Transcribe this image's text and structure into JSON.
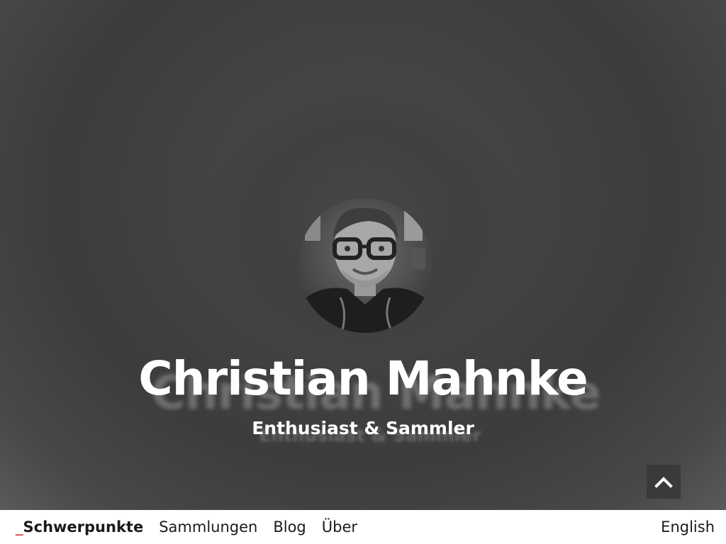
{
  "hero": {
    "name": "Christian Mahnke",
    "subtitle": "Enthusiast & Sammler",
    "portrait_icon": "portrait-photo",
    "scroll_top_icon": "chevron-up-icon"
  },
  "nav": {
    "active_prefix": "_",
    "items": [
      {
        "label": "Schwerpunkte",
        "active": true
      },
      {
        "label": "Sammlungen",
        "active": false
      },
      {
        "label": "Blog",
        "active": false
      },
      {
        "label": "Über",
        "active": false
      }
    ],
    "language": "English"
  },
  "colors": {
    "accent": "#d0233a",
    "hero_background": "#424242",
    "nav_background": "#ffffff",
    "text_dark": "#1a1a1a"
  }
}
